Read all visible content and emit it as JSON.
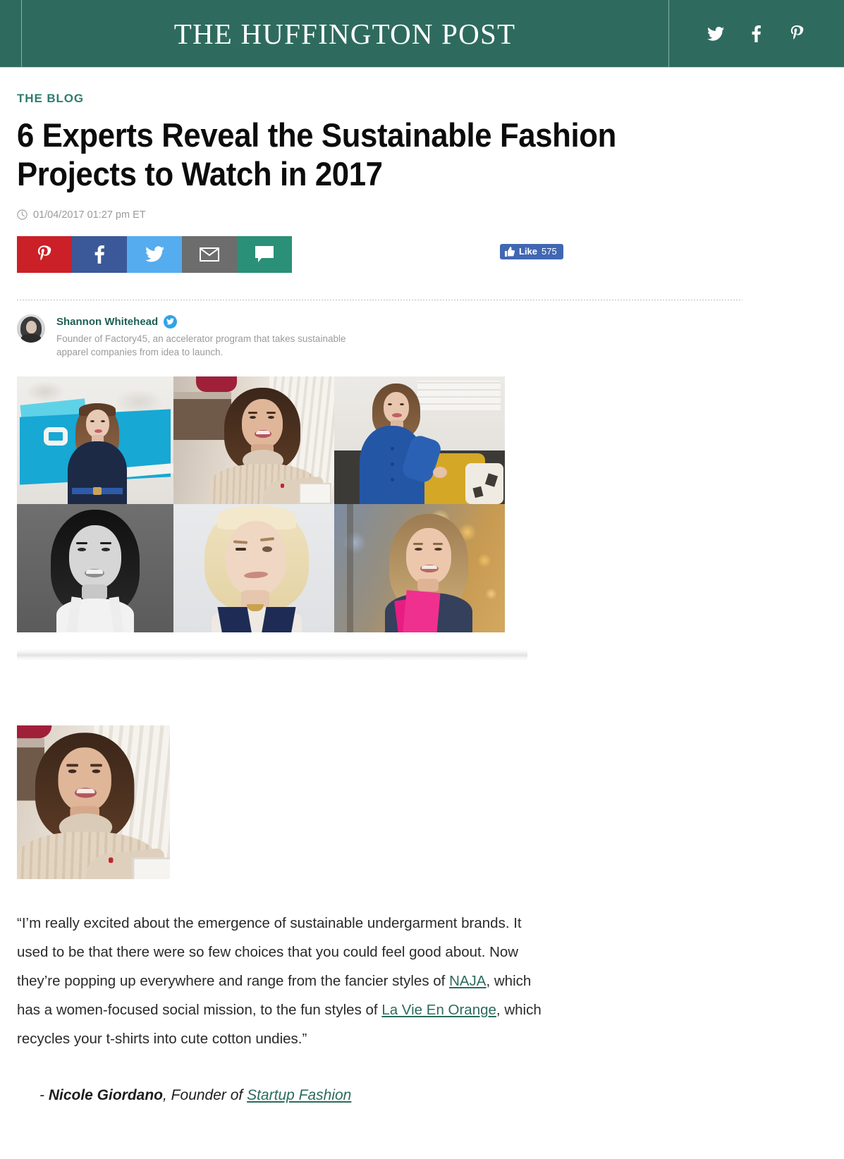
{
  "header": {
    "masthead": "THE HUFFINGTON POST",
    "social": [
      {
        "name": "twitter-icon",
        "label": "Twitter"
      },
      {
        "name": "facebook-icon",
        "label": "Facebook"
      },
      {
        "name": "pinterest-icon",
        "label": "Pinterest"
      }
    ],
    "brand_color": "#2e6b5e"
  },
  "article": {
    "kicker": "THE BLOG",
    "headline": "6 Experts Reveal the Sustainable Fashion Projects to Watch in 2017",
    "timestamp": "01/04/2017 01:27 pm ET",
    "share": {
      "pinterest_label": "Pinterest",
      "facebook_label": "Facebook",
      "twitter_label": "Twitter",
      "email_label": "Email",
      "comment_label": "Comment",
      "colors": {
        "pinterest": "#cb2027",
        "facebook": "#3b5998",
        "twitter": "#55acee",
        "email": "#6d6d6d",
        "comment": "#2a9077"
      }
    },
    "fb_like": {
      "label": "Like",
      "count": "575"
    },
    "author": {
      "name": "Shannon Whitehead",
      "bio": "Founder of Factory45, an accelerator program that takes sustainable apparel companies from idea to launch.",
      "twitter_badge": "twitter-icon"
    },
    "quote": {
      "part1": "“I’m really excited about the emergence of sustainable undergarment brands. It used to be that there were so few choices that you could feel good about. Now they’re popping up everywhere and range from the fancier styles of ",
      "link1": "NAJA",
      "part2": ", which has a women-focused social mission, to the fun styles of ",
      "link2": "La Vie En Orange",
      "part3": ", which recycles your t-shirts into cute cotton undies.”"
    },
    "attribution": {
      "dash": "- ",
      "who": "Nicole Giordano",
      "role": ", Founder of ",
      "link": "Startup Fashion"
    }
  }
}
